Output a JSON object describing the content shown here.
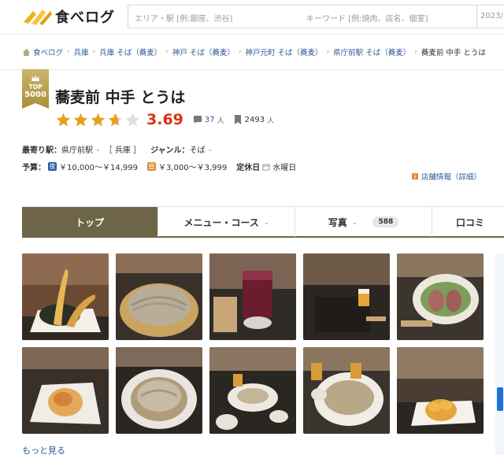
{
  "header": {
    "logo_text": "食べログ",
    "area_placeholder": "エリア・駅 [例:銀座、渋谷]",
    "keyword_placeholder": "キーワード [例:焼肉、店名、個室]",
    "date_text": "2023/"
  },
  "breadcrumb": [
    {
      "label": "食べログ"
    },
    {
      "label": "兵庫"
    },
    {
      "label": "兵庫 そば（蕎麦）"
    },
    {
      "label": "神戸 そば（蕎麦）"
    },
    {
      "label": "神戸元町 そば（蕎麦）"
    },
    {
      "label": "県庁前駅 そば（蕎麦）"
    },
    {
      "label": "蕎麦前 中手 とうは"
    }
  ],
  "badge": {
    "top": "TOP",
    "number": "5000"
  },
  "shop": {
    "name": "蕎麦前 中手 とうは",
    "score": "3.69",
    "rating_fraction": 0.69,
    "reviews": "37",
    "reviews_unit": "人",
    "saves": "2493",
    "saves_unit": "人"
  },
  "info": {
    "station_label": "最寄り駅：",
    "station": "県庁前駅",
    "pref": "［ 兵庫 ］",
    "genre_label": "ジャンル：",
    "genre": "そば",
    "budget_label": "予算：",
    "night_icon": "夜",
    "night_price": "￥10,000～￥14,999",
    "lunch_icon": "昼",
    "lunch_price": "￥3,000～￥3,999",
    "closed_label": "定休日",
    "closed": "水曜日",
    "store_info_link": "店舗情報（詳細）"
  },
  "tabs": [
    {
      "label": "トップ"
    },
    {
      "label": "メニュー・コース"
    },
    {
      "label": "写真",
      "count": "588"
    },
    {
      "label": "口コミ"
    }
  ],
  "photos_more": "もっと見る",
  "colors": {
    "accent": "#6e6549",
    "score": "#d9340f",
    "link": "#2d5b9a",
    "star": "#e6a016"
  }
}
